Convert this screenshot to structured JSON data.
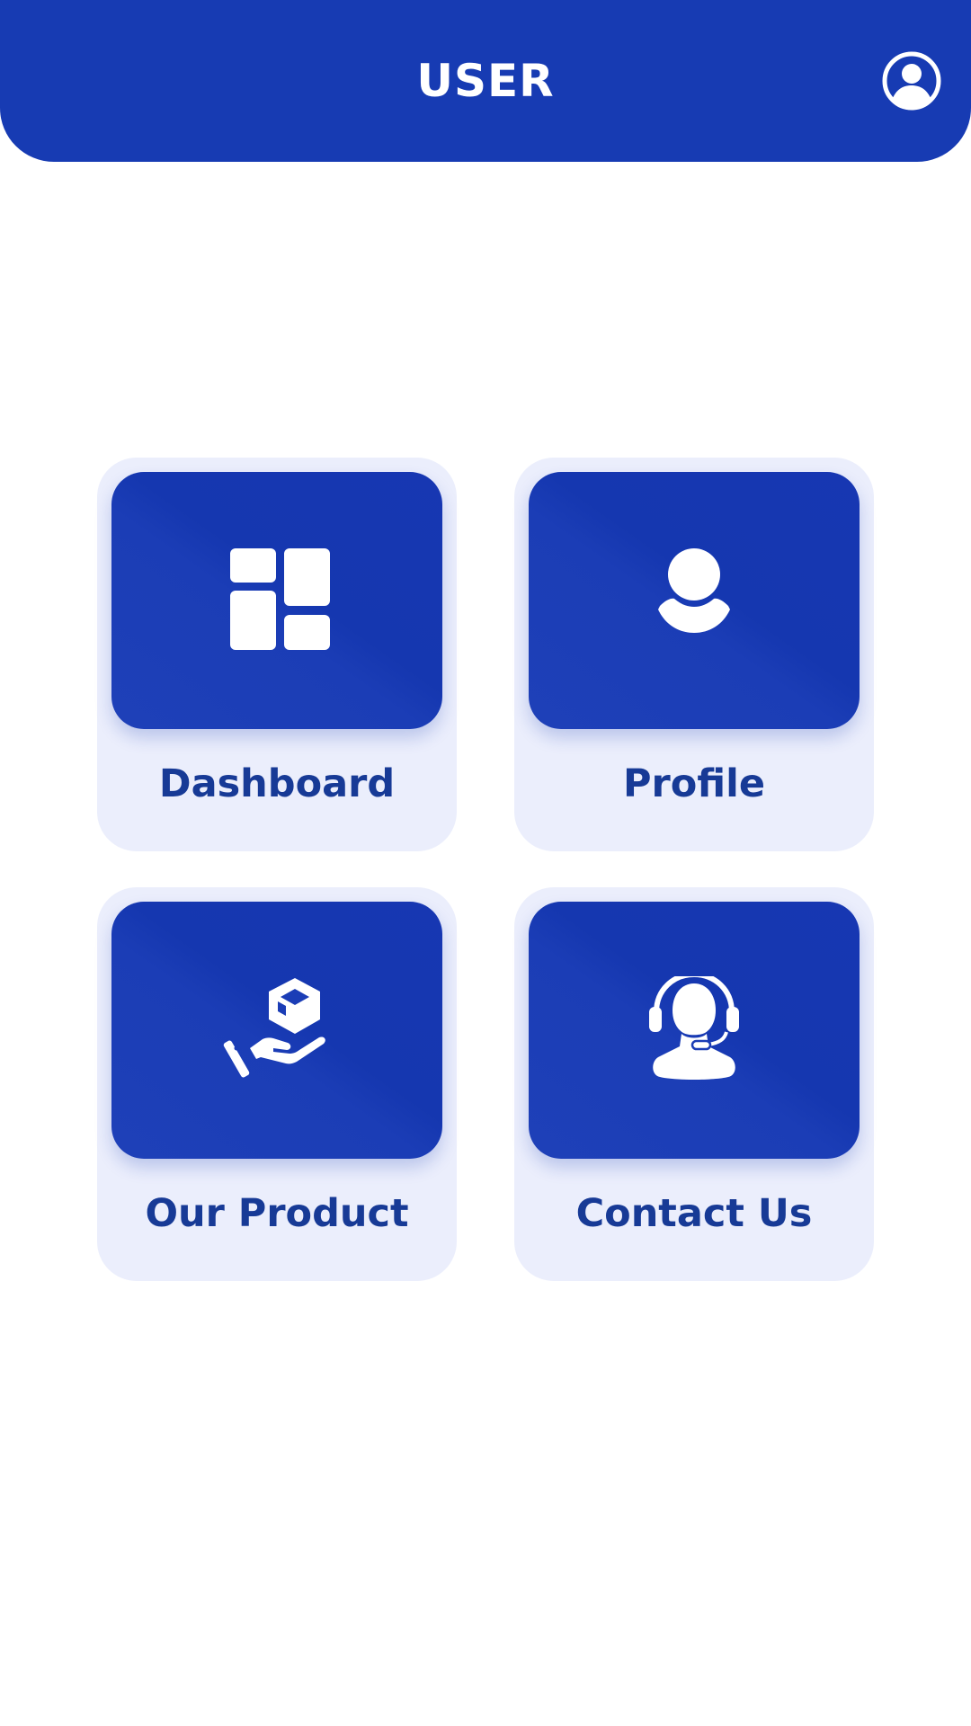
{
  "header": {
    "title": "USER",
    "account_icon": "user-circle-icon"
  },
  "colors": {
    "brand_blue": "#173bb3",
    "tile_background": "#ebeefc",
    "label_text": "#173a96",
    "icon_fill": "#ffffff"
  },
  "menu": {
    "items": [
      {
        "label": "Dashboard",
        "icon": "dashboard-icon"
      },
      {
        "label": "Profile",
        "icon": "person-icon"
      },
      {
        "label": "Our Product",
        "icon": "product-in-hand-icon"
      },
      {
        "label": "Contact Us",
        "icon": "headset-support-icon"
      }
    ]
  }
}
